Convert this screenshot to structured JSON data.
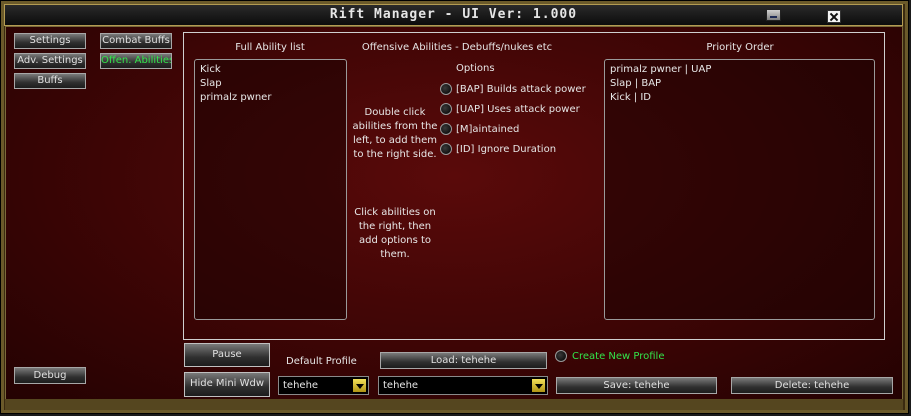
{
  "window": {
    "title": "Rift Manager - UI Ver: 1.000"
  },
  "nav": {
    "settings": "Settings",
    "adv_settings": "Adv. Settings",
    "buffs": "Buffs",
    "combat_buffs": "Combat Buffs",
    "offen_abilities": "Offen. Abilities",
    "debug": "Debug"
  },
  "panel": {
    "full_list_header": "Full Ability list",
    "section_title": "Offensive Abilities - Debuffs/nukes etc",
    "priority_header": "Priority Order",
    "full_list": [
      "Kick",
      "Slap",
      "primalz pwner"
    ],
    "priority_list": [
      "primalz pwner | UAP",
      "Slap | BAP",
      "Kick | ID"
    ],
    "options_label": "Options",
    "options": [
      "[BAP] Builds attack power",
      "[UAP] Uses attack power",
      "[M]aintained",
      "[ID] Ignore Duration"
    ],
    "help1": [
      "Double click",
      "abilities from the",
      "left, to add them",
      "to the right side."
    ],
    "help2": [
      "Click abilities on",
      "the right, then",
      "add options to",
      "them."
    ]
  },
  "footer": {
    "pause": "Pause",
    "hide_mini": "Hide Mini Wdw",
    "default_profile_label": "Default Profile",
    "default_profile_value": "tehehe",
    "load": "Load: tehehe",
    "profile_value": "tehehe",
    "create_new": "Create New Profile",
    "save": "Save: tehehe",
    "delete": "Delete: tehehe"
  },
  "colors": {
    "accent_green": "#32e54a",
    "background_red": "#3d0505",
    "frame_gold": "#6b5a2a"
  }
}
